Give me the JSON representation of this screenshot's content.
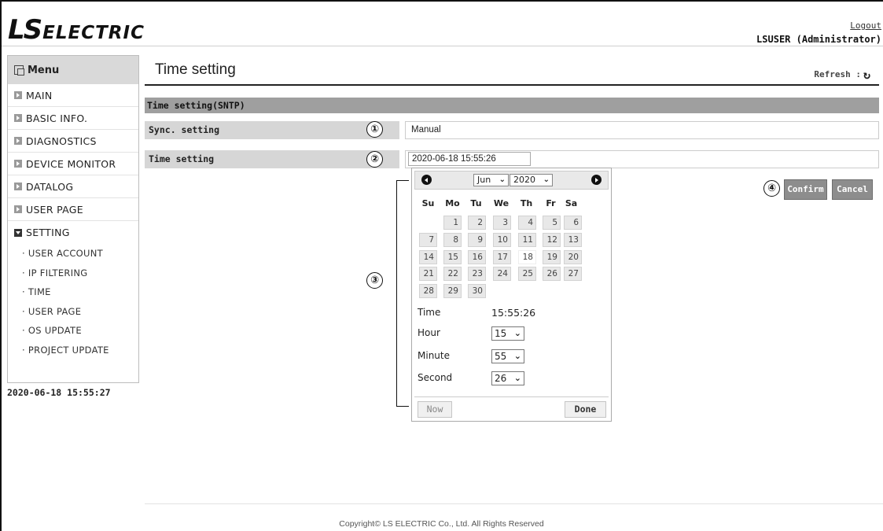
{
  "header": {
    "logo_ls": "LS",
    "logo_electric": "ELECTRIC",
    "logout": "Logout",
    "user": "LSUSER (Administrator)"
  },
  "sidebar": {
    "menu_label": "Menu",
    "items": [
      "MAIN",
      "BASIC INFO.",
      "DIAGNOSTICS",
      "DEVICE MONITOR",
      "DATALOG",
      "USER PAGE"
    ],
    "setting_label": "SETTING",
    "sub_items": [
      "USER ACCOUNT",
      "IP FILTERING",
      "TIME",
      "USER PAGE",
      "OS UPDATE",
      "PROJECT UPDATE"
    ],
    "clock": "2020-06-18 15:55:27"
  },
  "main": {
    "title": "Time setting",
    "refresh_label": "Refresh :",
    "section": "Time setting(SNTP)",
    "sync_label": "Sync. setting",
    "sync_value": "Manual",
    "time_label": "Time setting",
    "time_value": "2020-06-18 15:55:26",
    "confirm": "Confirm",
    "cancel": "Cancel"
  },
  "callouts": [
    "①",
    "②",
    "③",
    "④"
  ],
  "datepicker": {
    "month": "Jun",
    "year": "2020",
    "weekdays": [
      "Su",
      "Mo",
      "Tu",
      "We",
      "Th",
      "Fr",
      "Sa"
    ],
    "first_weekday_index": 1,
    "days_in_month": 30,
    "today": 18,
    "time_label": "Time",
    "time_value": "15:55:26",
    "hour_label": "Hour",
    "hour_value": "15",
    "minute_label": "Minute",
    "minute_value": "55",
    "second_label": "Second",
    "second_value": "26",
    "now_label": "Now",
    "done_label": "Done"
  },
  "footer": "Copyright© LS ELECTRIC Co., Ltd. All Rights Reserved"
}
